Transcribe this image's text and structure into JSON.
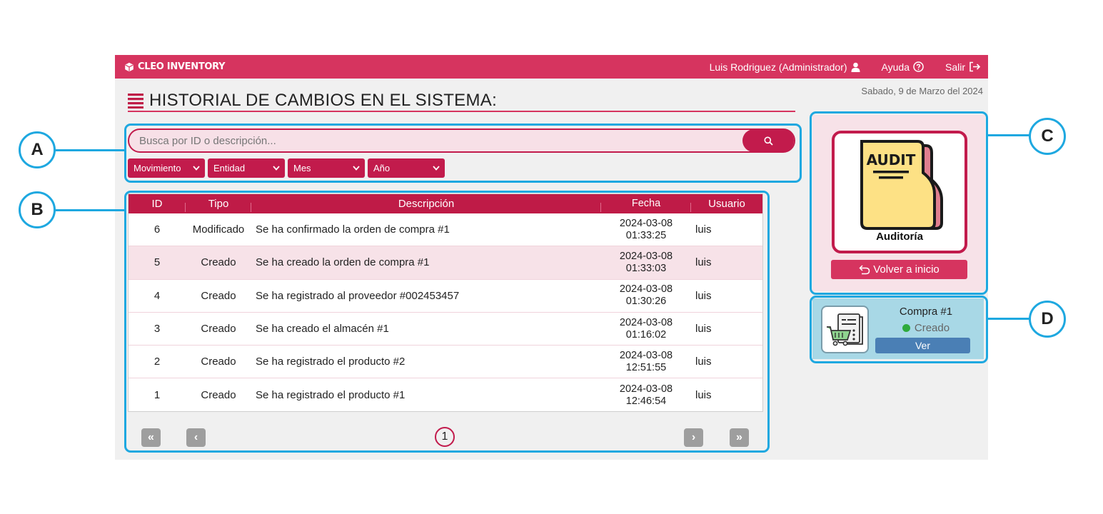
{
  "topbar": {
    "brand": "CLEO INVENTORY",
    "user": "Luis Rodriguez (Administrador)",
    "help": "Ayuda",
    "logout": "Salir"
  },
  "date": "Sabado, 9 de Marzo del 2024",
  "page_title": "HISTORIAL DE CAMBIOS EN EL SISTEMA:",
  "search": {
    "placeholder": "Busca por ID o descripción..."
  },
  "filters": [
    "Movimiento",
    "Entidad",
    "Mes",
    "Año"
  ],
  "table": {
    "headers": {
      "id": "ID",
      "tipo": "Tipo",
      "descripcion": "Descripción",
      "fecha": "Fecha",
      "usuario": "Usuario"
    },
    "rows": [
      {
        "id": "6",
        "tipo": "Modificado",
        "descripcion": "Se ha confirmado la orden de compra #1",
        "fecha": "2024-03-08",
        "hora": "01:33:25",
        "usuario": "luis"
      },
      {
        "id": "5",
        "tipo": "Creado",
        "descripcion": "Se ha creado la orden de compra #1",
        "fecha": "2024-03-08",
        "hora": "01:33:03",
        "usuario": "luis"
      },
      {
        "id": "4",
        "tipo": "Creado",
        "descripcion": "Se ha registrado al proveedor #002453457",
        "fecha": "2024-03-08",
        "hora": "01:30:26",
        "usuario": "luis"
      },
      {
        "id": "3",
        "tipo": "Creado",
        "descripcion": "Se ha creado el almacén #1",
        "fecha": "2024-03-08",
        "hora": "01:16:02",
        "usuario": "luis"
      },
      {
        "id": "2",
        "tipo": "Creado",
        "descripcion": "Se ha registrado el producto #2",
        "fecha": "2024-03-08",
        "hora": "12:51:55",
        "usuario": "luis"
      },
      {
        "id": "1",
        "tipo": "Creado",
        "descripcion": "Se ha registrado el producto #1",
        "fecha": "2024-03-08",
        "hora": "12:46:54",
        "usuario": "luis"
      }
    ]
  },
  "pagination": {
    "current_page": "1",
    "first": "«",
    "prev": "‹",
    "next": "›",
    "last": "»"
  },
  "audit_panel": {
    "card_title": "AUDIT",
    "label": "Auditoría",
    "back_button": "Volver a inicio"
  },
  "compra_card": {
    "title": "Compra #1",
    "status": "Creado",
    "view_button": "Ver"
  },
  "annotations": [
    "A",
    "B",
    "C",
    "D"
  ],
  "colors": {
    "primary": "#d6345f",
    "dark_primary": "#c21b4c",
    "highlight": "#1ea8e0",
    "panel_pink": "#f7e2e8",
    "card_blue": "#a8d8e6"
  }
}
